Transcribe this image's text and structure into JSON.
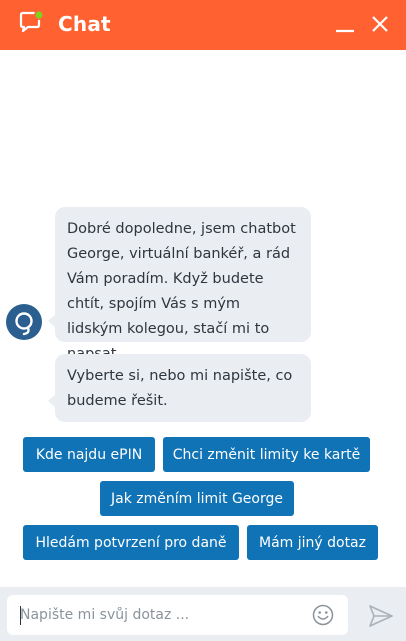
{
  "header": {
    "title": "Chat",
    "logo_icon": "chat-bubble-icon",
    "minimize_icon": "minimize-icon",
    "close_icon": "close-icon",
    "color": "#ff6130"
  },
  "messages": [
    {
      "text": "Dobré dopoledne, jsem chatbot George, virtuální bankéř, a rád Vám poradím. Když budete chtít, spojím Vás s mým lidským kolegou, stačí mi to napsat."
    },
    {
      "text": "Vyberte si, nebo mi napište, co budeme řešit."
    }
  ],
  "quick_replies": [
    "Kde najdu ePIN",
    "Chci změnit limity ke kartě",
    "Jak změním limit George",
    "Hledám potvrzení pro daně",
    "Mám jiný dotaz"
  ],
  "composer": {
    "placeholder": "Napište mi svůj dotaz ...",
    "value": "",
    "emoji_icon": "emoji-icon",
    "send_icon": "send-icon"
  },
  "colors": {
    "accent": "#0f73b6",
    "bubble": "#eaedf1",
    "avatar": "#2b5f8f"
  }
}
